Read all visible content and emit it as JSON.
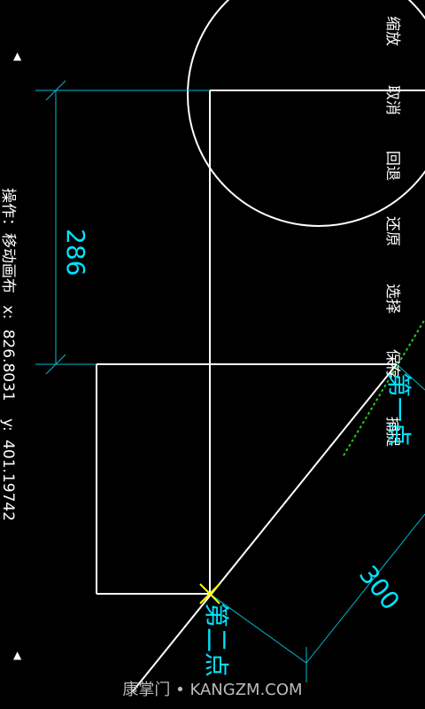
{
  "menu": {
    "zoom": "缩放",
    "cancel": "取消",
    "undo": "回退",
    "redo": "还原",
    "select": "选择",
    "save": "保存",
    "snap": "捕捉"
  },
  "status": {
    "operation_label": "操作：移动画布",
    "x_label": "x:",
    "x_value": "826.8031",
    "y_label": "y:",
    "y_value": "401.19742"
  },
  "drawing": {
    "dimension_1": "286",
    "dimension_2": "300",
    "point_1_label": "第一点",
    "point_2_label": "第二点"
  },
  "colors": {
    "background": "#000000",
    "geometry": "#ffffff",
    "dimension": "#00e5ff",
    "snap_marker": "#ffff00",
    "guide": "#22cc22"
  },
  "watermark": "康掌门 • KANGZM.COM"
}
